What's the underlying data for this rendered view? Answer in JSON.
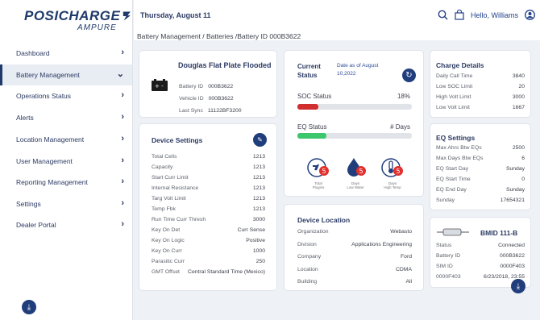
{
  "brand": {
    "name": "POSICHARGE",
    "sub": "AMPURE"
  },
  "colors": {
    "primary": "#213e7c",
    "soc_bar": "#d12f2f",
    "eq_bar": "#3cc76d",
    "badge": "#e0312f"
  },
  "sidebar": {
    "items": [
      {
        "label": "Dashboard",
        "icon": "chevron-right-icon"
      },
      {
        "label": "Battery Management",
        "icon": "chevron-down-icon"
      },
      {
        "label": "Operations Status",
        "icon": "chevron-right-icon"
      },
      {
        "label": "Alerts",
        "icon": "chevron-right-icon"
      },
      {
        "label": "Location Management",
        "icon": "chevron-right-icon"
      },
      {
        "label": "User Management",
        "icon": "chevron-right-icon"
      },
      {
        "label": "Reporting Management",
        "icon": "chevron-right-icon"
      },
      {
        "label": "Settings",
        "icon": "chevron-right-icon"
      },
      {
        "label": "Dealer Portal",
        "icon": "chevron-right-icon"
      }
    ]
  },
  "header": {
    "date": "Thursday, August 11",
    "greeting": "Hello, Williams",
    "breadcrumb": "Battery Management / Batteries /Battery ID 000B3622"
  },
  "battery": {
    "title": "Douglas Flat Plate Flooded",
    "battery_id_label": "Battery ID",
    "battery_id": "000B3622",
    "vehicle_id_label": "Vehicle ID",
    "vehicle_id": "000B3622",
    "last_sync_label": "Last Sync",
    "last_sync": "11122BF3200"
  },
  "device_settings": {
    "title": "Device Settings",
    "rows": [
      {
        "label": "Total Cells",
        "value": "1213"
      },
      {
        "label": "Capacity",
        "value": "1213"
      },
      {
        "label": "Start Curr Limit",
        "value": "1213"
      },
      {
        "label": "Internal Resistance",
        "value": "1213"
      },
      {
        "label": "Targ Volt Limit",
        "value": "1213"
      },
      {
        "label": "Temp Fbk",
        "value": "1213"
      },
      {
        "label": "Run Time Curr Thresh",
        "value": "3000"
      },
      {
        "label": "Key On Det",
        "value": "Curr Sense"
      },
      {
        "label": "Key On Logic",
        "value": "Positive"
      },
      {
        "label": "Key On Curr",
        "value": "1000"
      },
      {
        "label": "Parasitic Curr",
        "value": "250"
      },
      {
        "label": "GMT Offset",
        "value": "Central Standard Time (Mexico)"
      }
    ]
  },
  "status": {
    "title_line1": "Current",
    "title_line2": "Status",
    "date_label": "Date as of August",
    "date_value": "10,2022",
    "soc_label": "SOC Status",
    "soc_value": "18%",
    "soc_fraction": 0.18,
    "eq_label": "EQ Status",
    "eq_value": "# Days",
    "eq_fraction": 0.25,
    "icons": [
      {
        "name": "plug-icon",
        "badge": "5",
        "caption1": "Total",
        "caption2": "Plugins"
      },
      {
        "name": "water-drop-icon",
        "badge": "5",
        "caption1": "Days",
        "caption2": "Low Water"
      },
      {
        "name": "thermometer-icon",
        "badge": "5",
        "caption1": "Days",
        "caption2": "High Temp"
      }
    ]
  },
  "location": {
    "title": "Device Location",
    "rows": [
      {
        "label": "Organization",
        "value": "Webasto"
      },
      {
        "label": "Division",
        "value": "Applications Engineering"
      },
      {
        "label": "Company",
        "value": "Ford"
      },
      {
        "label": "Location",
        "value": "CDMA"
      },
      {
        "label": "Building",
        "value": "All"
      }
    ]
  },
  "charge": {
    "title": "Charge Details",
    "rows": [
      {
        "label": "Daily Call Time",
        "value": "3840"
      },
      {
        "label": "Low SOC Limit",
        "value": "20"
      },
      {
        "label": "High Volt Limit",
        "value": "3000"
      },
      {
        "label": "Low Volt Limit",
        "value": "1667"
      }
    ]
  },
  "eq_settings": {
    "title": "EQ Settings",
    "rows": [
      {
        "label": "Max Ahrs Btw EQs",
        "value": "2500"
      },
      {
        "label": "Max Days Btw EQs",
        "value": "6"
      },
      {
        "label": "EQ Start Day",
        "value": "Sunday"
      },
      {
        "label": "EQ Start Time",
        "value": "0"
      },
      {
        "label": "EQ End Day",
        "value": "Sunday"
      },
      {
        "label": "Sunday",
        "value": "17654321"
      }
    ]
  },
  "bmid": {
    "title": "BMID 111-B",
    "rows": [
      {
        "label": "Status",
        "value": "Connected"
      },
      {
        "label": "Battery ID",
        "value": "000B3622"
      },
      {
        "label": "SIM ID",
        "value": "0000F403"
      },
      {
        "label": "0000F403",
        "value": "6/23/2018, 23:55"
      }
    ]
  }
}
